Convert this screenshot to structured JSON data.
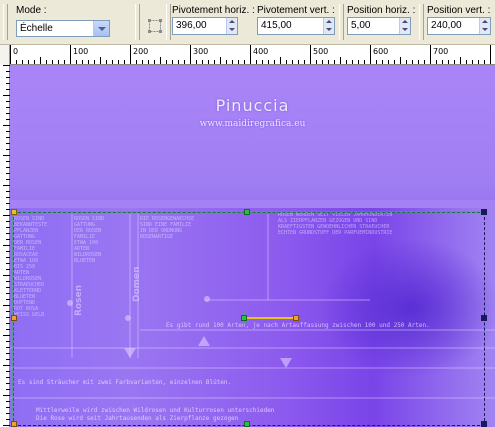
{
  "toolbar": {
    "mode_label": "Mode :",
    "mode_value": "Échelle",
    "pivot_h_label": "Pivotement horiz. :",
    "pivot_h_value": "396,00",
    "pivot_v_label": "Pivotement vert. :",
    "pivot_v_value": "415,00",
    "pos_h_label": "Position horiz. :",
    "pos_h_value": "5,00",
    "pos_v_label": "Position vert. :",
    "pos_v_value": "240,00"
  },
  "ruler": {
    "top_marks": [
      "0",
      "100",
      "200",
      "300",
      "400",
      "500",
      "600",
      "700"
    ]
  },
  "canvas": {
    "title": "Pinuccia",
    "site": "www.maidiregrafica.eu",
    "vertical_words": [
      "Rosen",
      "Domen"
    ],
    "line1": "Es gibt rund 100 Arten, je nach Artauffassung zwischen 100 und 250 Arten.",
    "line2": "Es sind Sträucher mit zwei Farbvarianten, einzelnen Blüten.",
    "line3": "Mittlerweile wird zwischen Wildrosen und Kulturrosen unterschieden",
    "line4": "Die Rose wird seit Jahrtausenden als Zierpflanze gezogen",
    "colors": {
      "canvas_top": "#a884f6",
      "canvas_dark": "#5a2fd4",
      "handle_green": "#2dbf45",
      "handle_orange": "#f0a030",
      "guide_yellow": "#e8c21b",
      "selection": "#1a1a5a"
    }
  }
}
